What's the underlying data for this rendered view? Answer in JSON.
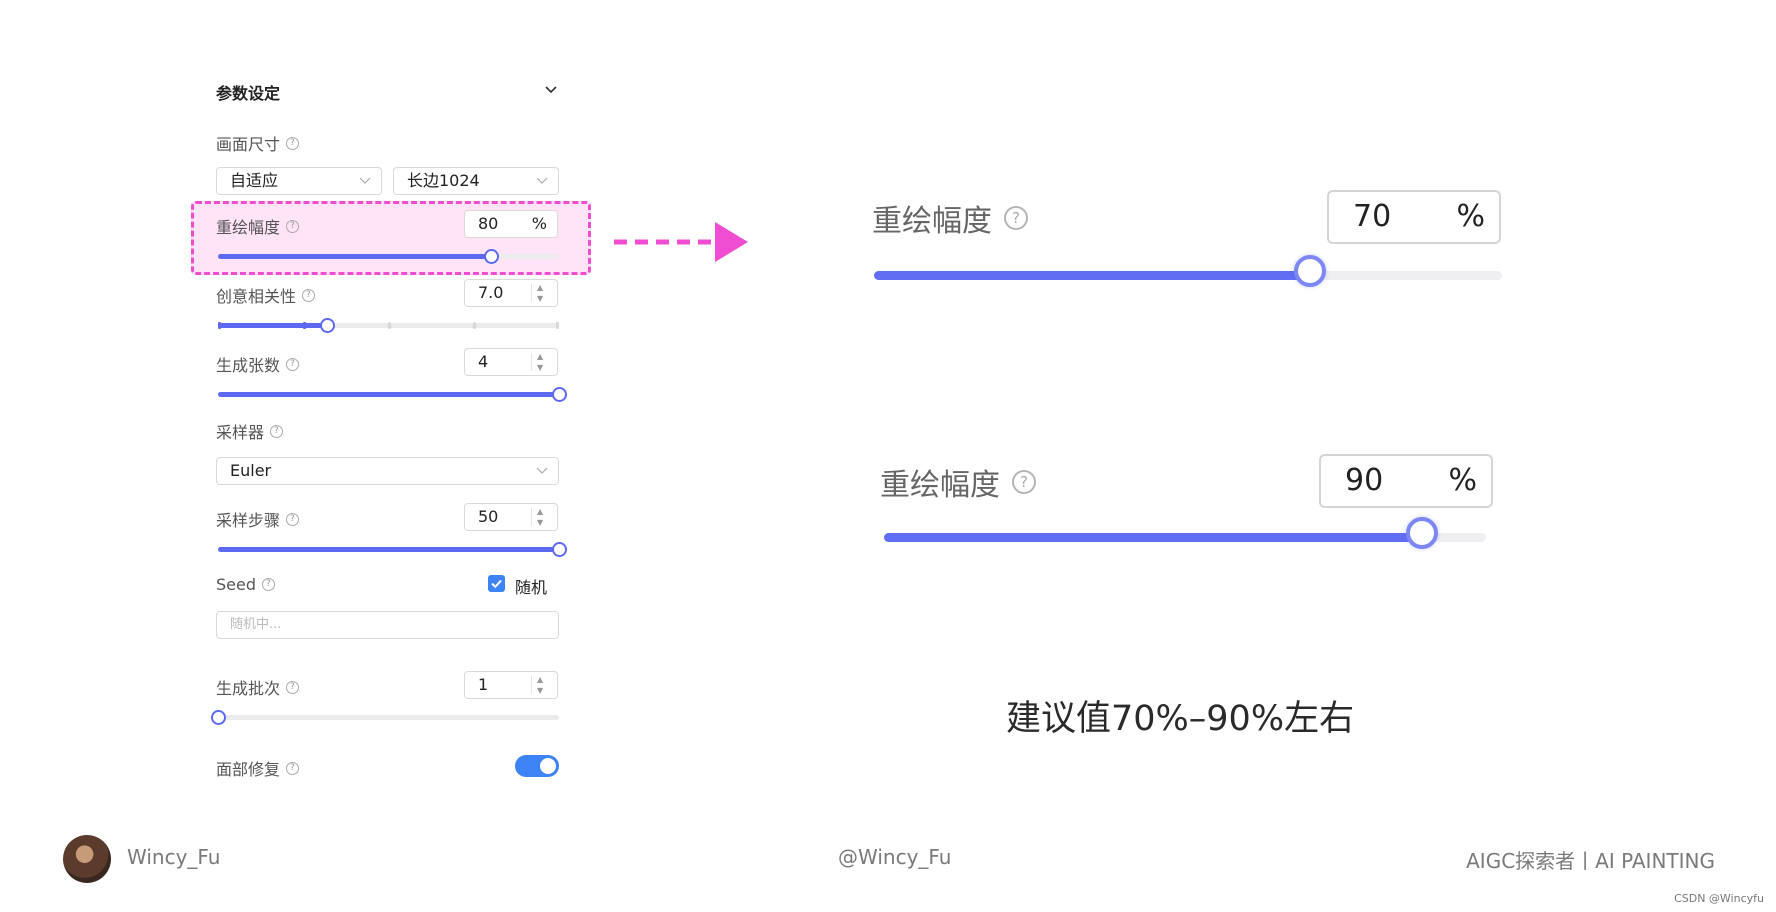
{
  "panel": {
    "title": "参数设定",
    "canvas_size": {
      "label": "画面尺寸",
      "mode": "自适应",
      "edge": "长边1024"
    },
    "redraw": {
      "label": "重绘幅度",
      "value": "80",
      "unit": "%",
      "level": 0.8
    },
    "creativity": {
      "label": "创意相关性",
      "value": "7.0",
      "level": 0.32
    },
    "count": {
      "label": "生成张数",
      "value": "4",
      "level": 1.0
    },
    "sampler": {
      "label": "采样器",
      "value": "Euler"
    },
    "steps": {
      "label": "采样步骤",
      "value": "50",
      "level": 1.0
    },
    "seed": {
      "label": "Seed",
      "random_label": "随机",
      "random_checked": true,
      "placeholder": "随机中..."
    },
    "batch": {
      "label": "生成批次",
      "value": "1",
      "level": 0.0
    },
    "face_fix": {
      "label": "面部修复",
      "enabled": true
    }
  },
  "zoom": [
    {
      "label": "重绘幅度",
      "value": "70",
      "unit": "%",
      "level": 0.7
    },
    {
      "label": "重绘幅度",
      "value": "90",
      "unit": "%",
      "level": 0.9
    }
  ],
  "suggestion": "建议值70%–90%左右",
  "footer": {
    "author": "Wincy_Fu",
    "handle": "@Wincy_Fu",
    "brand": "AIGC探索者丨AI PAINTING",
    "watermark": "CSDN @Wincyfu"
  },
  "colors": {
    "accent": "#5b6af0",
    "highlight": "#f04ed2",
    "toggle": "#3d83f5"
  }
}
